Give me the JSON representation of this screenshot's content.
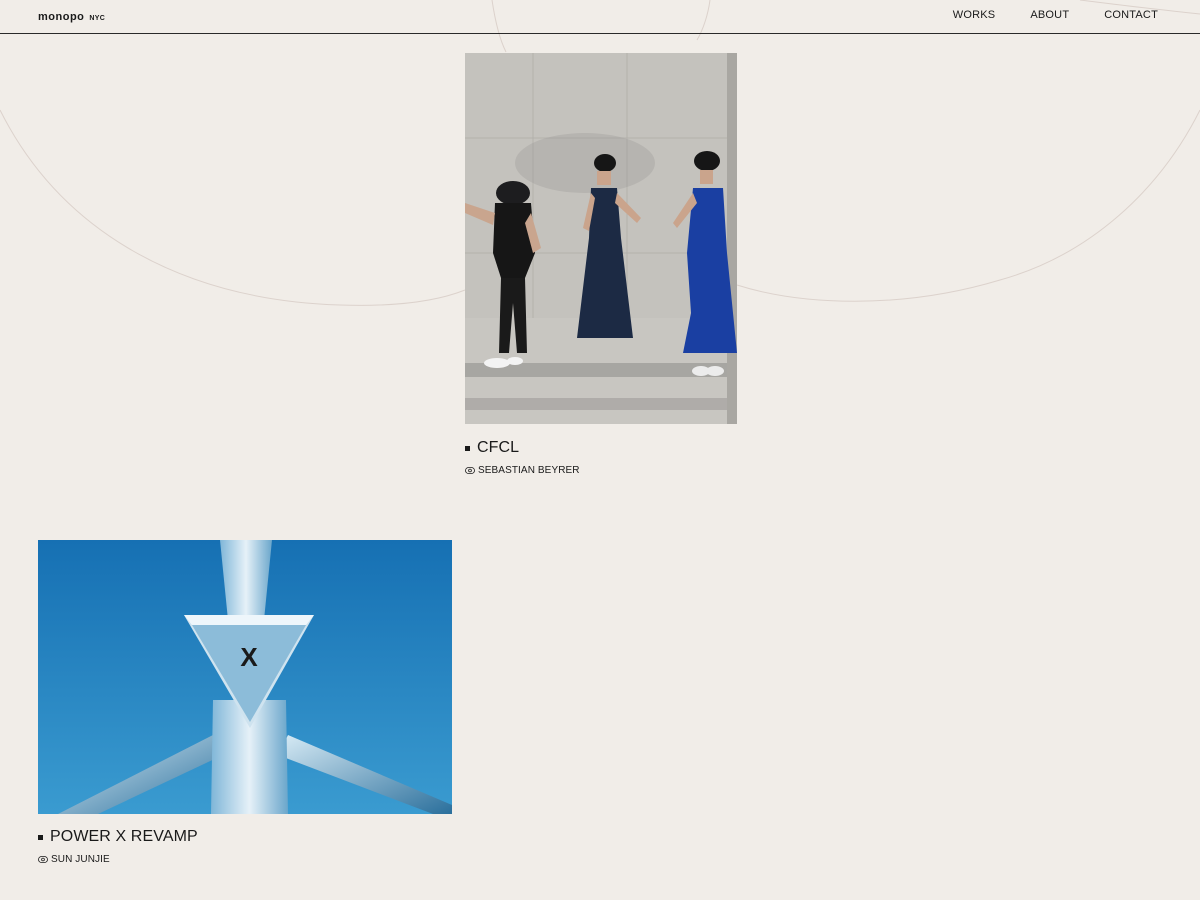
{
  "header": {
    "logo": {
      "word": "monopo",
      "city": "NYC"
    },
    "nav": [
      {
        "label": "WORKS"
      },
      {
        "label": "ABOUT"
      },
      {
        "label": "CONTACT"
      }
    ]
  },
  "works": [
    {
      "title": "CFCL",
      "credit": "SEBASTIAN BEYRER",
      "credit_icon": "eye-link-icon"
    },
    {
      "title": "POWER X REVAMP",
      "credit": "SUN JUNJIE",
      "credit_icon": "eye-link-icon"
    }
  ],
  "colors": {
    "background": "#f1ede8",
    "text": "#1a1a1a",
    "power_sky": "#1b7dbd"
  }
}
